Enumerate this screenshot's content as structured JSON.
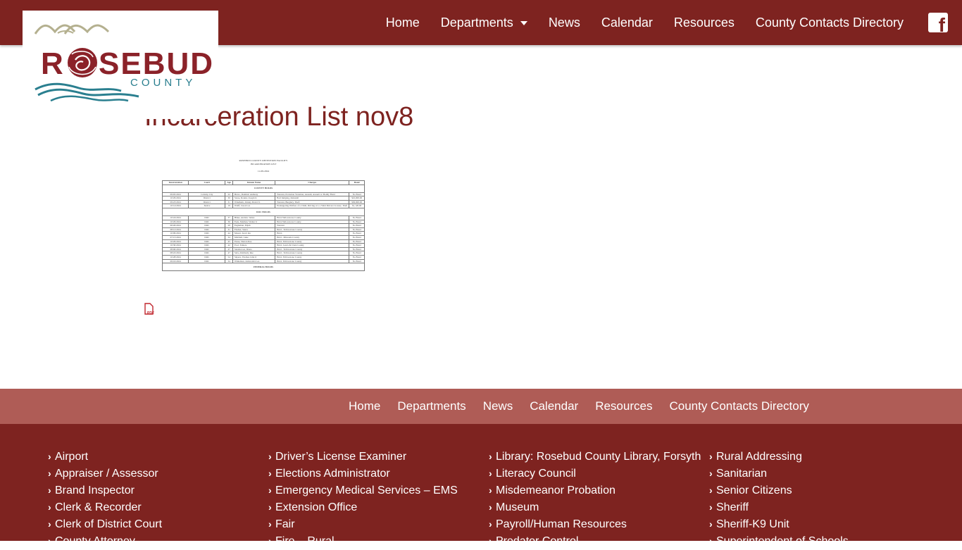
{
  "logo": {
    "wordmark": "ROSEBUD",
    "subtitle": "COUNTY",
    "alt": "Rosebud County"
  },
  "header": {
    "nav": [
      {
        "label": "Home"
      },
      {
        "label": "Departments",
        "has_dropdown": true
      },
      {
        "label": "News"
      },
      {
        "label": "Calendar"
      },
      {
        "label": "Resources"
      },
      {
        "label": "County Contacts Directory"
      }
    ],
    "social": {
      "icon": "facebook-icon",
      "glyph": "f"
    }
  },
  "main": {
    "title": "Incarceration List nov8",
    "document": {
      "heading_line1": "ROSEBUD COUNTY DETENTION FACILITY",
      "heading_line2": "INCARCERATION LIST",
      "date": "11-08-2024",
      "columns": [
        "Incarceration",
        "Court",
        "Age",
        "Inmate Name",
        "Charges",
        "Bond"
      ],
      "sections": [
        {
          "name": "COUNTY HOLDS",
          "rows": [
            [
              "09/05/2024",
              "Colstrip City",
              "22",
              "Bravo, Dominic Anthony",
              "Warrant, Probation Violation, Assault, Assault w/ Bodily Fluid",
              "No Bond"
            ],
            [
              "10/29/2024",
              "District",
              "30",
              "Stone, Ronnie Joseph Jr.",
              "Bail Jumping, Reinstall",
              "$10,000.00"
            ],
            [
              "09/23/2024",
              "District",
              "31",
              "Windham, Johnny David Jr.",
              "Warrant, Burglary, Theft",
              "$30,000.00"
            ],
            [
              "10/14/2024",
              "Justice",
              "19",
              "Wolff, Jason Lee",
              "Endangering Welfare of a Child, Driving w/o a Valid Drivers License, Theft",
              "$1,120.00"
            ]
          ]
        },
        {
          "name": "DOC HOLDS",
          "rows": [
            [
              "10/24/2024",
              "DOC",
              "37",
              "Blake, Andrew James",
              "Hold-Yellowstone County",
              "No Bond"
            ],
            [
              "10/29/2024",
              "DOC",
              "36",
              "Eads, Matthew Walter Jr",
              "Hold-Yellowstone County",
              "No Bond"
            ],
            [
              "06/26/2024",
              "DOC",
              "29",
              "Eagleman, Elijah",
              "Warrant",
              "No Bond"
            ],
            [
              "08/12/2024",
              "DOC",
              "31",
              "Fischer, Sierra",
              "Hold - Yellowstone County",
              "No Bond"
            ],
            [
              "10/09/2024",
              "DOC",
              "44",
              "Mount, Jacob Ian",
              "Hold-",
              "No Bond"
            ],
            [
              "07/15/2024",
              "DOC",
              "34",
              "Mitchell, Luke",
              "Hold - Missoula County",
              "No Bond"
            ],
            [
              "10/29/2024",
              "DOC",
              "45",
              "Pease, Sharon Rae",
              "Hold- Yellowstone County",
              "No Bond"
            ],
            [
              "10/30/2024",
              "DOC",
              "42",
              "Pool, Tamera",
              "Hold- Lewis & Clark County",
              "No Bond"
            ],
            [
              "08/06/2024",
              "DOC",
              "47",
              "Sandra-Lee, Diana",
              "Hold - Yellowstone County",
              "No Bond"
            ],
            [
              "08/22/2024",
              "DOC",
              "47",
              "Sabo, Kimberly Rae",
              "Hold - Yellowstone County",
              "No Bond"
            ],
            [
              "10/28/2024",
              "DOC",
              "54",
              "Skyera, Thomas John Jr",
              "Hold- Yellowstone County",
              "No Bond"
            ],
            [
              "09/16/2024",
              "DOC",
              "34",
              "Whiteman, Jeshawnda Lee",
              "Hold- Yellowstone County",
              "No Bond"
            ]
          ]
        },
        {
          "name": "FEDERAL HOLDS",
          "rows": []
        }
      ]
    },
    "pdf_icon": {
      "label": "PDF"
    }
  },
  "footer_nav": [
    {
      "label": "Home"
    },
    {
      "label": "Departments"
    },
    {
      "label": "News"
    },
    {
      "label": "Calendar"
    },
    {
      "label": "Resources"
    },
    {
      "label": "County Contacts Directory"
    }
  ],
  "footer_links": {
    "col1": [
      "Airport",
      "Appraiser / Assessor",
      "Brand Inspector",
      "Clerk & Recorder",
      "Clerk of District Court",
      "County Attorney"
    ],
    "col2": [
      "Driver’s License Examiner",
      "Elections Administrator",
      "Emergency Medical Services – EMS",
      "Extension Office",
      "Fair",
      "Fire – Rural"
    ],
    "col3": [
      "Library: Rosebud County Library, Forsyth",
      "Literacy Council",
      "Misdemeanor Probation",
      "Museum",
      "Payroll/Human Resources",
      "Predator Control"
    ],
    "col4": [
      "Rural Addressing",
      "Sanitarian",
      "Senior Citizens",
      "Sheriff",
      "Sheriff-K9 Unit",
      "Superintendent of Schools"
    ]
  },
  "colors": {
    "brand": "#7e2320",
    "footer_nav_bg": "#af5c56",
    "logo_teal": "#2a7f8f",
    "logo_tan": "#b4b08f"
  }
}
